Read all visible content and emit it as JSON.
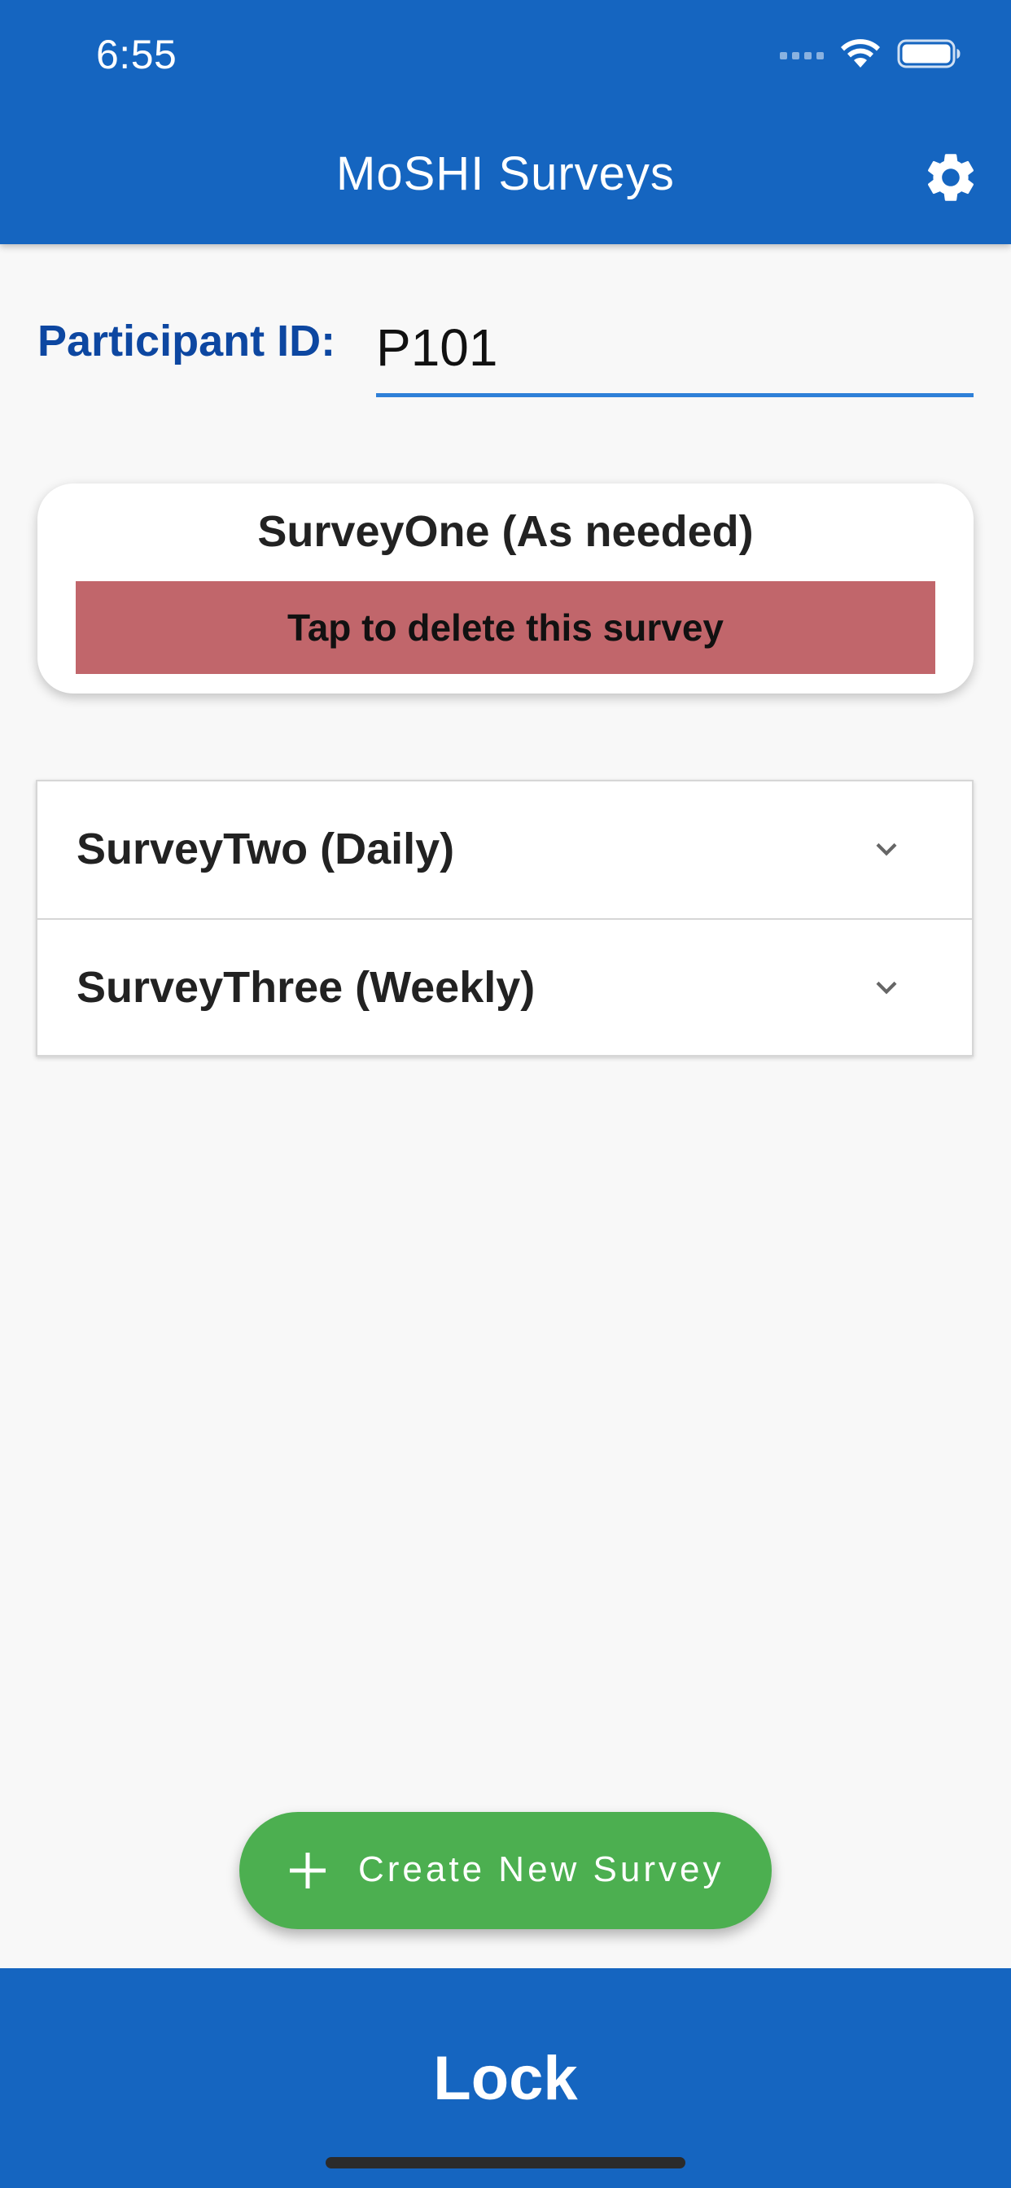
{
  "status_bar": {
    "time": "6:55"
  },
  "app_bar": {
    "title": "MoSHI Surveys",
    "settings_icon": "gear-icon"
  },
  "participant": {
    "label": "Participant ID:",
    "value": "P101",
    "placeholder": ""
  },
  "survey_one": {
    "title": "SurveyOne (As needed)",
    "delete_label": "Tap to delete this survey"
  },
  "surveys": [
    {
      "title": "SurveyTwo (Daily)",
      "icon": "chevron-down-icon"
    },
    {
      "title": "SurveyThree (Weekly)",
      "icon": "chevron-down-icon"
    }
  ],
  "fab": {
    "label": "Create New Survey",
    "icon": "plus-icon"
  },
  "bottom_bar": {
    "label": "Lock"
  },
  "colors": {
    "primary": "#1565c0",
    "delete": "#c1666b",
    "fab": "#4caf50",
    "label": "#0d47a1"
  }
}
